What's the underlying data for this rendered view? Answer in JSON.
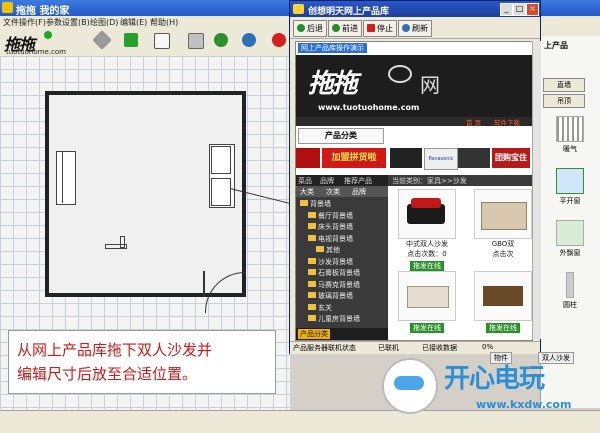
{
  "app": {
    "title": "拖拖 我的家"
  },
  "menu": [
    "文件操作(F)",
    "参数设置(B)",
    "绘图(D)",
    "编辑(E)",
    "帮助(H)"
  ],
  "logo": {
    "text": "拖拖",
    "url": "tuotuohome.com"
  },
  "caption": {
    "line1": "从网上产品库拖下双人沙发并",
    "line2": "编辑尺寸后放至合适位置。"
  },
  "product_window": {
    "title": "创想明天网上产品库",
    "nav": {
      "back": "后退",
      "forward": "前进",
      "stop": "停止",
      "refresh": "刷新"
    },
    "band_label": "网上产品库操作演示",
    "banner": {
      "logo": "拖拖",
      "wang": "网",
      "url": "www.tuotuohome.com"
    },
    "links": {
      "home": "首 页",
      "download": "软件下载"
    },
    "category_tab": "产品分类",
    "ads": {
      "promo": "加盟拼货啦",
      "ad2": "",
      "ad3": "Panasonic",
      "ad4": "",
      "group": "团购宝住"
    },
    "left_tabs": [
      "菜品",
      "品牌",
      "推荐产品"
    ],
    "tree_head": [
      "大类",
      "次类",
      "品牌"
    ],
    "tree": [
      {
        "label": "背景墙",
        "indent": 0
      },
      {
        "label": "餐厅背景墙",
        "indent": 1
      },
      {
        "label": "床头背景墙",
        "indent": 1
      },
      {
        "label": "电视背景墙",
        "indent": 1
      },
      {
        "label": "其他",
        "indent": 2
      },
      {
        "label": "沙发背景墙",
        "indent": 1
      },
      {
        "label": "石膏板背景墙",
        "indent": 1
      },
      {
        "label": "马赛克背景墙",
        "indent": 1
      },
      {
        "label": "玻璃背景墙",
        "indent": 1
      },
      {
        "label": "玄关",
        "indent": 1
      },
      {
        "label": "儿童房背景墙",
        "indent": 1
      }
    ],
    "bottom_tab": "产品分类",
    "current_category": "当前类别：家具>>沙发",
    "products": [
      {
        "name": "中式双人沙发",
        "clicks": "点击次数：0",
        "button": "拖发在线"
      },
      {
        "name": "GBO双",
        "clicks": "点击次",
        "button": ""
      },
      {
        "name": "",
        "clicks": "",
        "button": "拖发在线"
      },
      {
        "name": "",
        "clicks": "",
        "button": "拖发在线"
      }
    ],
    "status": {
      "server": "产品服务器联机状态",
      "online": "已联机",
      "data": "已接收数据",
      "percent": "0%"
    }
  },
  "right_panel": {
    "header": "上产品",
    "buttons": [
      "直墙",
      "吊顶"
    ],
    "items": [
      {
        "label": "暖气"
      },
      {
        "label": "平开窗"
      },
      {
        "label": "外飘窗"
      },
      {
        "label": "圆柱"
      }
    ],
    "tags": [
      "物件",
      "双人沙发"
    ]
  },
  "watermark": {
    "text": "开心电玩",
    "url": "www.kxdw.com"
  },
  "colors": {
    "accent": "#2b58c8",
    "caption": "#cc1a1a",
    "watermark": "#2b8fd8"
  }
}
